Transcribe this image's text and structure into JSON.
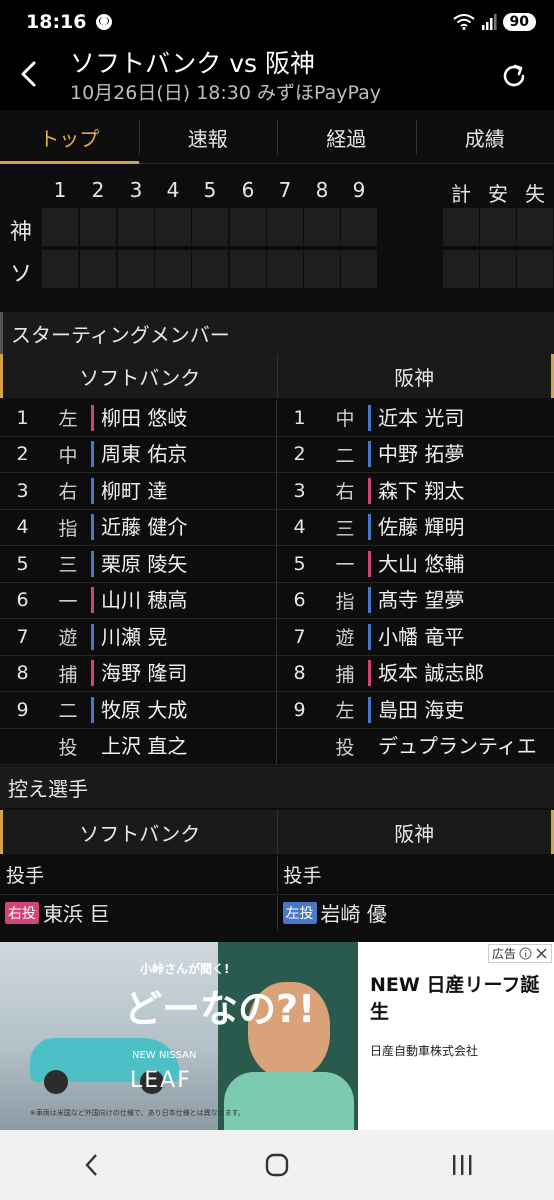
{
  "status_bar": {
    "time": "18:16",
    "battery": "90"
  },
  "header": {
    "title": "ソフトバンク vs 阪神",
    "subtitle": "10月26日(日) 18:30 みずほPayPay"
  },
  "tabs": [
    {
      "label": "トップ",
      "active": true
    },
    {
      "label": "速報",
      "active": false
    },
    {
      "label": "経過",
      "active": false
    },
    {
      "label": "成績",
      "active": false
    }
  ],
  "scoreboard": {
    "innings": [
      "1",
      "2",
      "3",
      "4",
      "5",
      "6",
      "7",
      "8",
      "9"
    ],
    "totals": [
      "計",
      "安",
      "失"
    ],
    "teams": [
      "神",
      "ソ"
    ]
  },
  "starting": {
    "title": "スターティングメンバー",
    "team_left": "ソフトバンク",
    "team_right": "阪神",
    "left": [
      {
        "order": "1",
        "pos": "左",
        "name": "柳田 悠岐",
        "bat": "L"
      },
      {
        "order": "2",
        "pos": "中",
        "name": "周東 佑京",
        "bat": "R"
      },
      {
        "order": "3",
        "pos": "右",
        "name": "柳町 達",
        "bat": "R"
      },
      {
        "order": "4",
        "pos": "指",
        "name": "近藤 健介",
        "bat": "R"
      },
      {
        "order": "5",
        "pos": "三",
        "name": "栗原 陵矢",
        "bat": "R"
      },
      {
        "order": "6",
        "pos": "一",
        "name": "山川 穂高",
        "bat": "L"
      },
      {
        "order": "7",
        "pos": "遊",
        "name": "川瀬 晃",
        "bat": "R"
      },
      {
        "order": "8",
        "pos": "捕",
        "name": "海野 隆司",
        "bat": "L"
      },
      {
        "order": "9",
        "pos": "二",
        "name": "牧原 大成",
        "bat": "R"
      },
      {
        "order": "",
        "pos": "投",
        "name": "上沢 直之",
        "bat": "none"
      }
    ],
    "right": [
      {
        "order": "1",
        "pos": "中",
        "name": "近本 光司",
        "bat": "R"
      },
      {
        "order": "2",
        "pos": "二",
        "name": "中野 拓夢",
        "bat": "R"
      },
      {
        "order": "3",
        "pos": "右",
        "name": "森下 翔太",
        "bat": "L"
      },
      {
        "order": "4",
        "pos": "三",
        "name": "佐藤 輝明",
        "bat": "R"
      },
      {
        "order": "5",
        "pos": "一",
        "name": "大山 悠輔",
        "bat": "L"
      },
      {
        "order": "6",
        "pos": "指",
        "name": "髙寺 望夢",
        "bat": "R"
      },
      {
        "order": "7",
        "pos": "遊",
        "name": "小幡 竜平",
        "bat": "R"
      },
      {
        "order": "8",
        "pos": "捕",
        "name": "坂本 誠志郎",
        "bat": "L"
      },
      {
        "order": "9",
        "pos": "左",
        "name": "島田 海吏",
        "bat": "R"
      },
      {
        "order": "",
        "pos": "投",
        "name": "デュプランティエ",
        "bat": "none"
      }
    ]
  },
  "bench": {
    "title": "控え選手",
    "team_left": "ソフトバンク",
    "team_right": "阪神",
    "sub_left": "投手",
    "sub_right": "投手",
    "left_player": {
      "tag": "右投",
      "name": "東浜 巨",
      "tag_color": "#d0447a"
    },
    "right_player": {
      "tag": "左投",
      "name": "岩崎 優",
      "tag_color": "#4a78c8"
    }
  },
  "ad": {
    "headline": "NEW 日産リーフ誕生",
    "company": "日産自動車株式会社",
    "badge": "広告",
    "img_line1": "小峠さんが聞く!",
    "img_line2": "どーなの?!",
    "img_line3": "NEW NISSAN",
    "img_line4": "LEAF",
    "img_note": "※車両は米国など外国向けの仕様で、あり日本仕様とは異なります。"
  },
  "colors": {
    "accent": "#d8a14e",
    "right_hand": "#4a78c8",
    "left_hand": "#d0447a"
  }
}
